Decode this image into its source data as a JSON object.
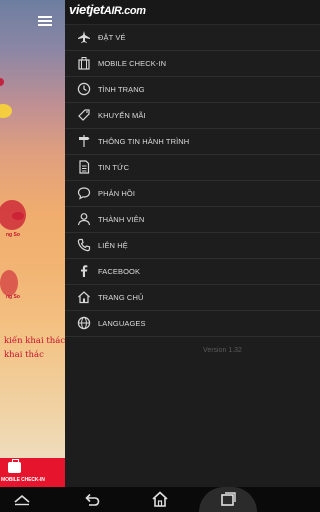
{
  "left_pane": {
    "text_line1": "kiến khai thác",
    "text_line2": "khai thác",
    "small1": "ng So",
    "small2": "ng So",
    "checkin_label": "MOBILE CHECK-IN"
  },
  "drawer": {
    "logo_main": "vietjet",
    "logo_air": "AIR.com",
    "items": [
      {
        "label": "ĐẶT VÉ",
        "icon": "airplane-icon"
      },
      {
        "label": "MOBILE CHECK-IN",
        "icon": "luggage-icon"
      },
      {
        "label": "TÌNH TRẠNG",
        "icon": "clock-icon"
      },
      {
        "label": "KHUYẾN MÃI",
        "icon": "price-tag-icon"
      },
      {
        "label": "THÔNG TIN HÀNH TRÌNH",
        "icon": "signpost-icon"
      },
      {
        "label": "TIN TỨC",
        "icon": "document-icon"
      },
      {
        "label": "PHẢN HỒI",
        "icon": "chat-bubble-icon"
      },
      {
        "label": "THÀNH VIÊN",
        "icon": "user-icon"
      },
      {
        "label": "LIÊN HỆ",
        "icon": "phone-icon"
      },
      {
        "label": "FACEBOOK",
        "icon": "facebook-icon"
      },
      {
        "label": "TRANG CHỦ",
        "icon": "home-icon"
      },
      {
        "label": "LANGUAGES",
        "icon": "globe-icon"
      }
    ],
    "version": "Version 1.32"
  }
}
